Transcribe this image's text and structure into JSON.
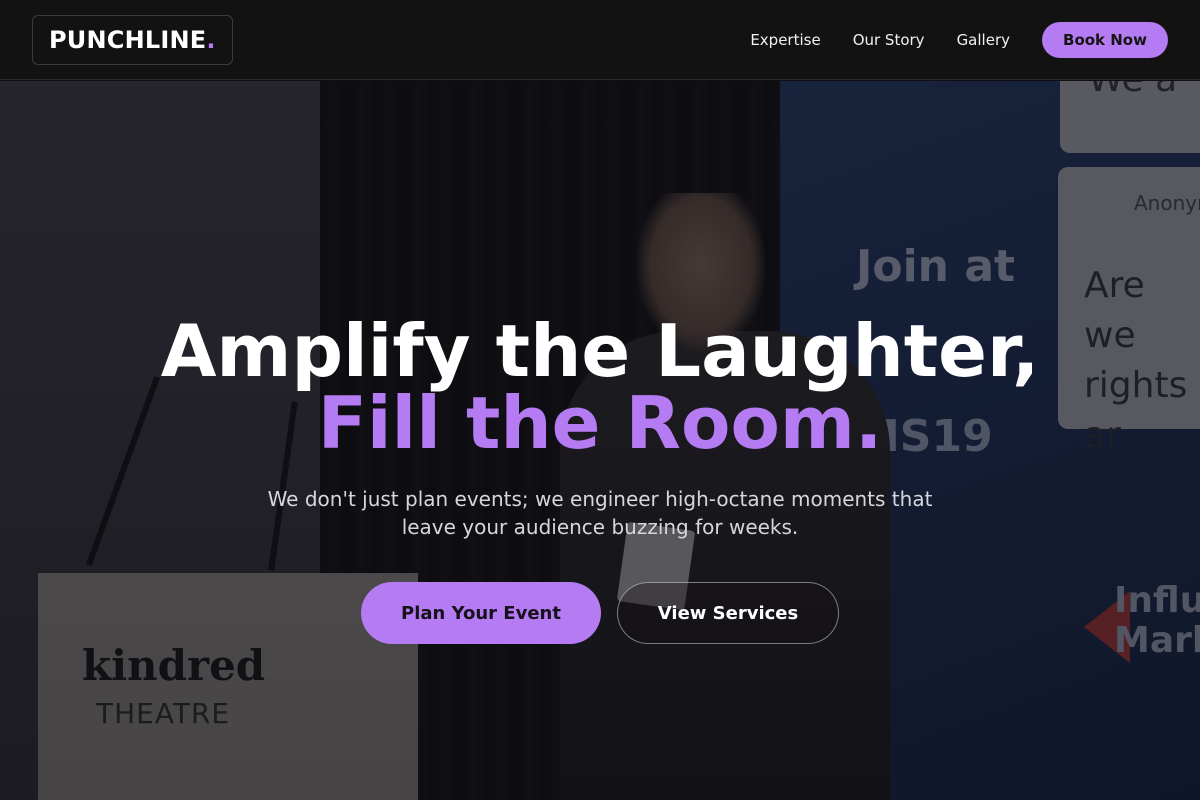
{
  "nav": {
    "logo_text": "PUNCHLINE",
    "logo_dot": ".",
    "links": [
      "Expertise",
      "Our Story",
      "Gallery"
    ],
    "book_label": "Book Now"
  },
  "hero": {
    "headline_line1": "Amplify the Laughter,",
    "headline_line2": "Fill the Room.",
    "subtext": "We don't just plan events; we engineer high-octane moments that leave your audience buzzing for weeks.",
    "primary_cta": "Plan Your Event",
    "secondary_cta": "View Services",
    "background_signage": {
      "lectern_name": "kindred",
      "lectern_sub": "THEATRE",
      "banner_join": "Join at",
      "banner_code": "MS19",
      "panel_user": "Anonym",
      "panel_text": "Are we rights ar",
      "panel_top": "We a",
      "banner_brand": "Influe Mark"
    }
  },
  "colors": {
    "accent": "#b57bf2",
    "nav_bg": "#121212",
    "text": "#ffffff"
  }
}
